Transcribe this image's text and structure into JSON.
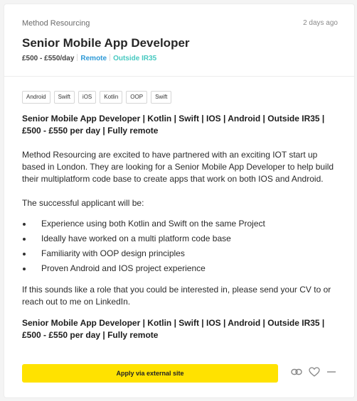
{
  "job": {
    "company": "Method Resourcing",
    "posted": "2 days ago",
    "title": "Senior Mobile App Developer",
    "rate": "£500 - £550/day",
    "location_type": "Remote",
    "ir35": "Outside IR35"
  },
  "tags": [
    "Android",
    "Swift",
    "iOS",
    "Kotlin",
    "OOP",
    "Swift"
  ],
  "description": {
    "headline": "Senior Mobile App Developer | Kotlin | Swift | IOS | Android | Outside IR35 | £500 - £550 per day | Fully remote",
    "intro": "Method Resourcing are excited to have partnered with an exciting IOT start up based in London. They are looking for a Senior Mobile App Developer to help build their multiplatform code base to create apps that work on both IOS and Android.",
    "applicant_intro": "The successful applicant will be:",
    "bullets": [
      "Experience using both Kotlin and Swift on the same Project",
      "Ideally have worked on a multi platform code base",
      "Familiarity with OOP design principles",
      "Proven Android and IOS project experience"
    ],
    "call_to_action": "If this sounds like a role that you could be interested in, please send your CV to or reach out to me on LinkedIn.",
    "closing_headline": "Senior Mobile App Developer | Kotlin | Swift | IOS | Android | Outside IR35 | £500 - £550 per day | Fully remote"
  },
  "actions": {
    "apply_label": "Apply via external site",
    "icons": [
      "link-icon",
      "heart-icon",
      "dismiss-icon"
    ]
  },
  "colors": {
    "apply_button": "#ffe200",
    "remote": "#2f9ad7",
    "ir35": "#47c9c0"
  }
}
